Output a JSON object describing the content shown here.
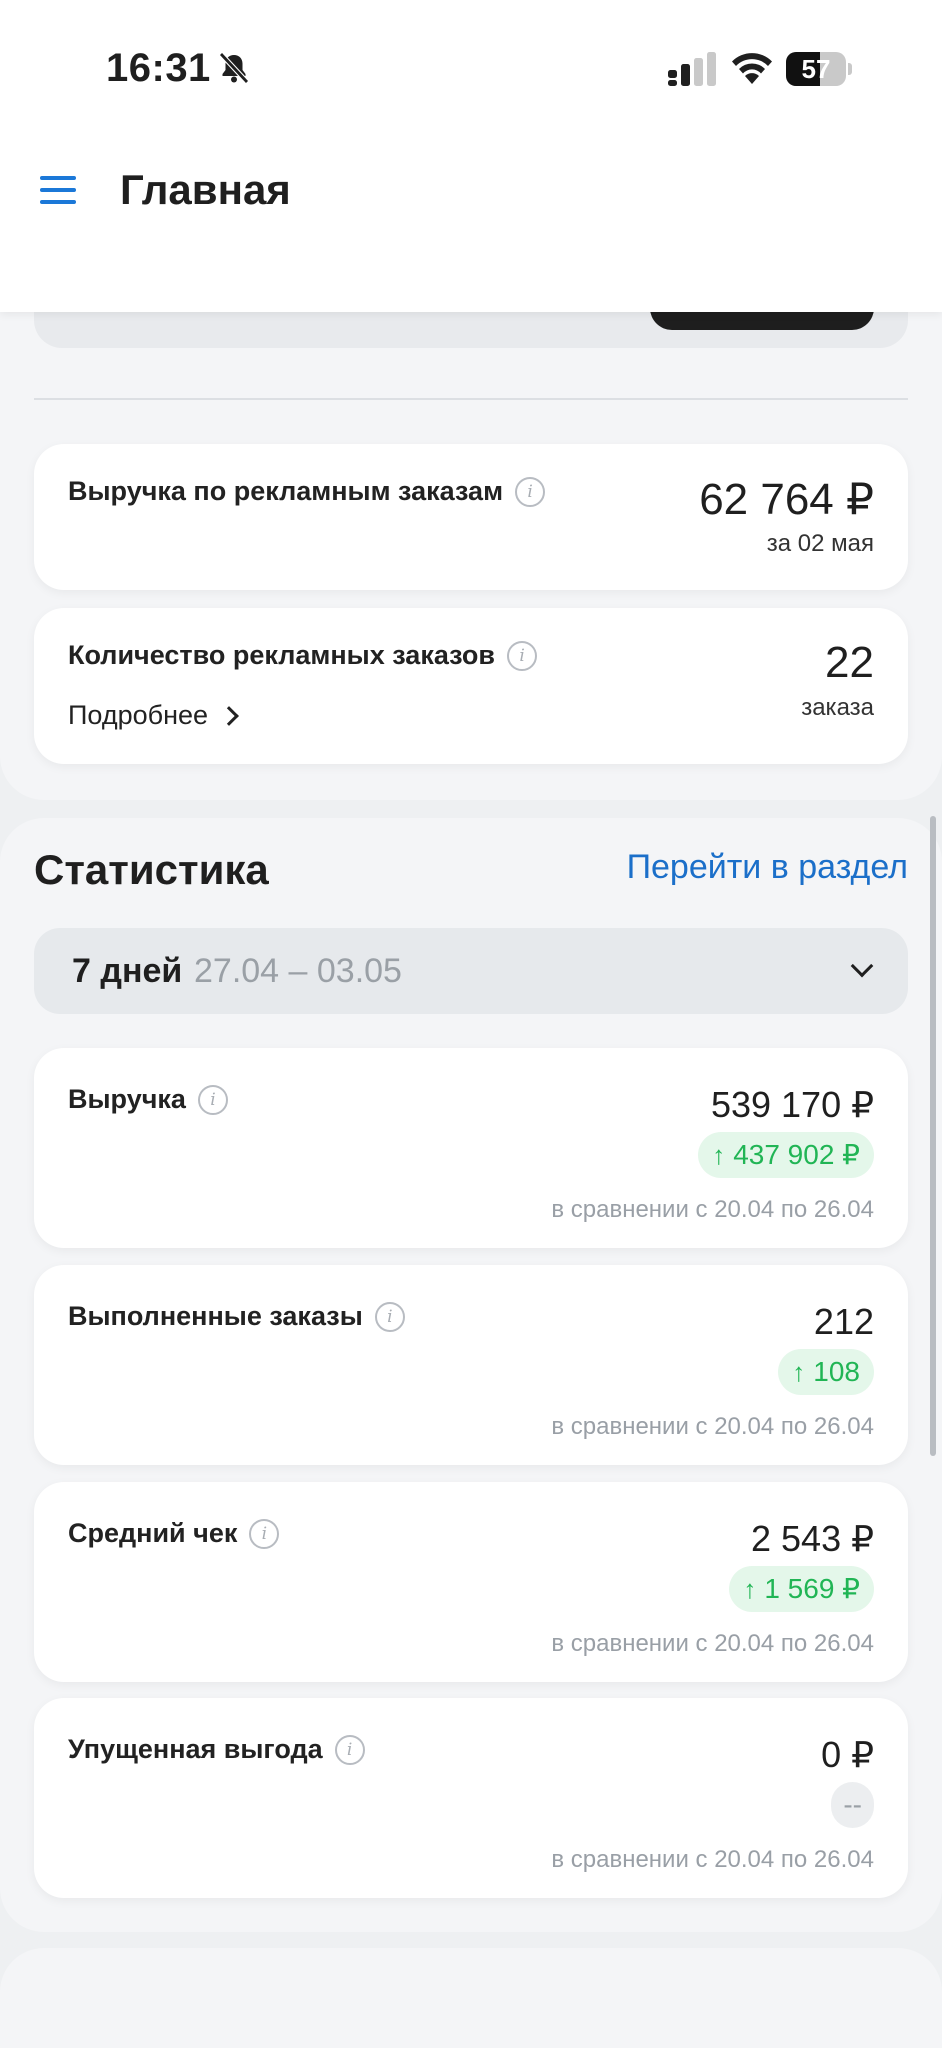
{
  "status_bar": {
    "time": "16:31",
    "battery_level": 57,
    "battery_label": "57"
  },
  "header": {
    "title": "Главная",
    "menu_icon": "hamburger-menu-icon"
  },
  "ads_section": {
    "revenue_card": {
      "label": "Выручка по рекламным заказам",
      "value": "62 764 ₽",
      "sub": "за 02 мая"
    },
    "orders_card": {
      "label": "Количество рекламных заказов",
      "value": "22",
      "sub": "заказа",
      "details_link": "Подробнее"
    }
  },
  "statistics": {
    "title": "Статистика",
    "go_link": "Перейти в раздел",
    "period": {
      "label": "7 дней",
      "range": "27.04 – 03.05"
    },
    "cards": [
      {
        "label": "Выручка",
        "value": "539 170 ₽",
        "delta": "437 902 ₽",
        "delta_dir": "up",
        "compare": "в сравнении с 20.04 по 26.04"
      },
      {
        "label": "Выполненные заказы",
        "value": "212",
        "delta": "108",
        "delta_dir": "up",
        "compare": "в сравнении с 20.04 по 26.04"
      },
      {
        "label": "Средний чек",
        "value": "2 543 ₽",
        "delta": "1 569 ₽",
        "delta_dir": "up",
        "compare": "в сравнении с 20.04 по 26.04"
      },
      {
        "label": "Упущенная выгода",
        "value": "0 ₽",
        "delta": "--",
        "delta_dir": "none",
        "compare": "в сравнении с 20.04 по 26.04"
      }
    ]
  },
  "colors": {
    "accent_blue": "#1b6fc9",
    "positive_green": "#21b555",
    "positive_bg": "#e4f7ea"
  }
}
